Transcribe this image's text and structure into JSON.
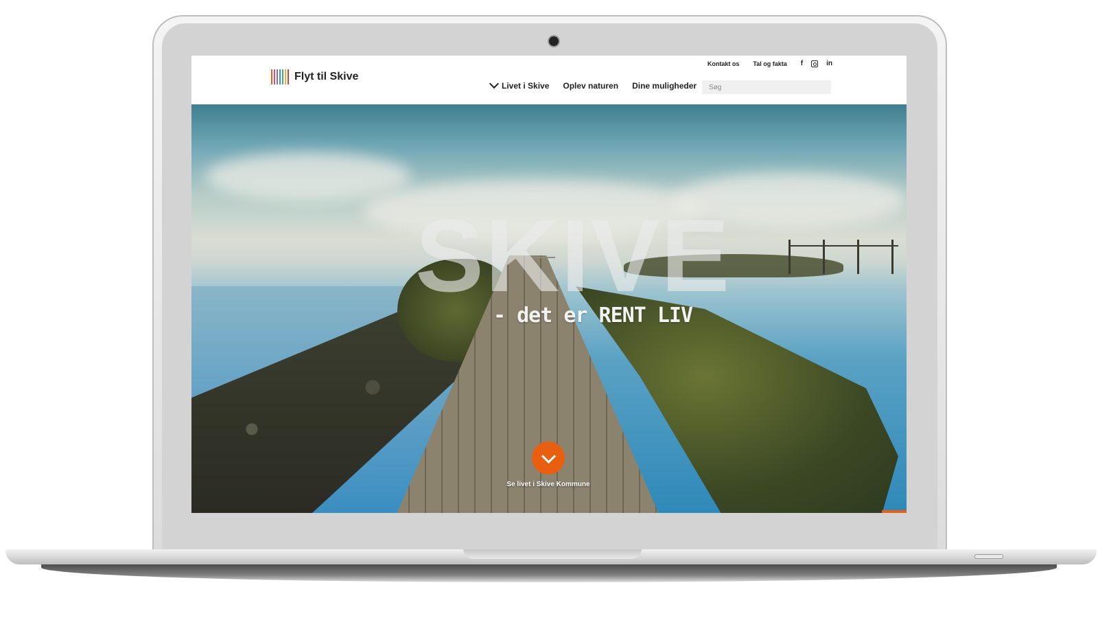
{
  "site": {
    "logo_text": "Flyt til Skive",
    "logo_colors": [
      "#e8600f",
      "#d94f7a",
      "#8a6bb0",
      "#3a8fc8",
      "#43a97a",
      "#e0b43a",
      "#c44"
    ]
  },
  "header": {
    "top_links": [
      "Kontakt os",
      "Tal og fakta"
    ],
    "social_icons": [
      "facebook-icon",
      "instagram-icon",
      "linkedin-icon"
    ],
    "social_glyphs": {
      "facebook": "f",
      "linkedin": "in"
    },
    "nav": [
      "Livet i Skive",
      "Oplev naturen",
      "Dine muligheder"
    ],
    "search_placeholder": "Søg"
  },
  "hero": {
    "title": "SKIVE",
    "subtitle": "- det er RENT LIV",
    "scroll_label": "Se livet i Skive Kommune"
  },
  "colors": {
    "accent": "#e8600f"
  }
}
